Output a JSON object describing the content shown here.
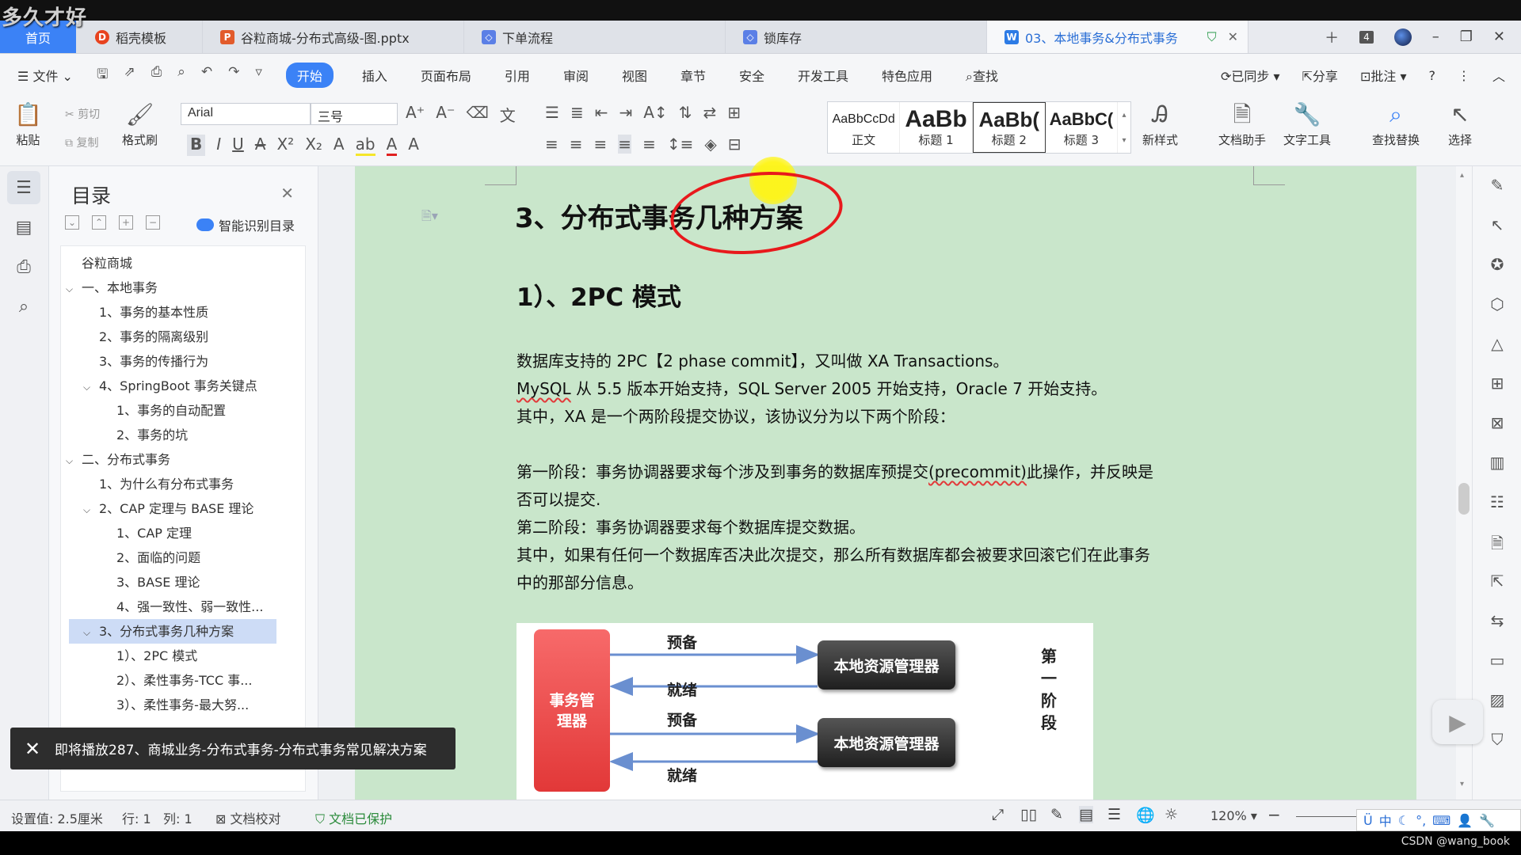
{
  "watermark": "多久才好",
  "tabs": {
    "home": "首页",
    "items": [
      {
        "label": "稻壳模板",
        "icon": "docer-icon"
      },
      {
        "label": "谷粒商城-分布式高级-图.pptx",
        "icon": "ppt-icon"
      },
      {
        "label": "下单流程",
        "icon": "flow-icon"
      },
      {
        "label": "锁库存",
        "icon": "flow-icon"
      },
      {
        "label": "03、本地事务&分布式事务",
        "icon": "word-icon"
      }
    ],
    "tab_count": "4"
  },
  "menu": {
    "file": "文件",
    "items": [
      "开始",
      "插入",
      "页面布局",
      "引用",
      "审阅",
      "视图",
      "章节",
      "安全",
      "开发工具",
      "特色应用"
    ],
    "search": "查找",
    "synced": "已同步",
    "share": "分享",
    "comment": "批注"
  },
  "ribbon": {
    "paste": "粘贴",
    "cut": "剪切",
    "copy": "复制",
    "format_painter": "格式刷",
    "font": "Arial",
    "size": "三号",
    "styles": [
      {
        "preview": "AaBbCcDd",
        "label": "正文"
      },
      {
        "preview": "AaBb",
        "label": "标题 1"
      },
      {
        "preview": "AaBb(",
        "label": "标题 2"
      },
      {
        "preview": "AaBbC(",
        "label": "标题 3"
      }
    ],
    "new_style": "新样式",
    "doc_assistant": "文档助手",
    "text_tools": "文字工具",
    "find_replace": "查找替换",
    "select": "选择"
  },
  "toc": {
    "title": "目录",
    "smart": "智能识别目录",
    "items": [
      {
        "label": "谷粒商城",
        "level": 0,
        "arrow": ""
      },
      {
        "label": "一、本地事务",
        "level": 0,
        "arrow": "v"
      },
      {
        "label": "1、事务的基本性质",
        "level": 1,
        "arrow": ""
      },
      {
        "label": "2、事务的隔离级别",
        "level": 1,
        "arrow": ""
      },
      {
        "label": "3、事务的传播行为",
        "level": 1,
        "arrow": ""
      },
      {
        "label": "4、SpringBoot 事务关键点",
        "level": 1,
        "arrow": "v"
      },
      {
        "label": "1、事务的自动配置",
        "level": 2,
        "arrow": ""
      },
      {
        "label": "2、事务的坑",
        "level": 2,
        "arrow": ""
      },
      {
        "label": "二、分布式事务",
        "level": 0,
        "arrow": "v"
      },
      {
        "label": "1、为什么有分布式事务",
        "level": 1,
        "arrow": ""
      },
      {
        "label": "2、CAP 定理与 BASE 理论",
        "level": 1,
        "arrow": "v"
      },
      {
        "label": "1、CAP 定理",
        "level": 2,
        "arrow": ""
      },
      {
        "label": "2、面临的问题",
        "level": 2,
        "arrow": ""
      },
      {
        "label": "3、BASE 理论",
        "level": 2,
        "arrow": ""
      },
      {
        "label": "4、强一致性、弱一致性...",
        "level": 2,
        "arrow": ""
      },
      {
        "label": "3、分布式事务几种方案",
        "level": 1,
        "arrow": "v",
        "highlight": true
      },
      {
        "label": "1）、2PC 模式",
        "level": 2,
        "arrow": ""
      },
      {
        "label": "2）、柔性事务-TCC 事...",
        "level": 2,
        "arrow": ""
      },
      {
        "label": "3）、柔性事务-最大努...",
        "level": 2,
        "arrow": ""
      }
    ]
  },
  "doc": {
    "h3": "3、分布式事务几种方案",
    "h4": "1）、2PC 模式",
    "p1": "数据库支持的 2PC【2 phase commit】，又叫做  XA Transactions。",
    "p2_a": "MySQL",
    "p2_b": " 从 5.5 版本开始支持，SQL Server 2005  开始支持，Oracle 7  开始支持。",
    "p3": "其中，XA  是一个两阶段提交协议，该协议分为以下两个阶段：",
    "p4_a": "第一阶段：事务协调器要求每个涉及到事务的数据库预提交",
    "p4_b": "(precommit)",
    "p4_c": "此操作，并反映是",
    "p5": "否可以提交.",
    "p6": "第二阶段：事务协调器要求每个数据库提交数据。",
    "p7": "其中，如果有任何一个数据库否决此次提交，那么所有数据库都会被要求回滚它们在此事务",
    "p8": "中的那部分信息。"
  },
  "diagram": {
    "tm_line1": "事务管",
    "tm_line2": "理器",
    "rm": "本地资源管理器",
    "prepare": "预备",
    "ready": "就绪",
    "phase": [
      "第",
      "一",
      "阶",
      "段"
    ]
  },
  "toast": "即将播放287、商城业务-分布式事务-分布式事务常见解决方案",
  "status": {
    "setting": "设置值: 2.5厘米",
    "row": "行: 1",
    "col": "列: 1",
    "proofread": "文档校对",
    "protected": "文档已保护",
    "zoom": "120%"
  },
  "ime": "中",
  "credit": "CSDN @wang_book",
  "colors": {
    "accent": "#3b82f6",
    "page": "#c9e6cb",
    "annotation": "#e8191c"
  }
}
